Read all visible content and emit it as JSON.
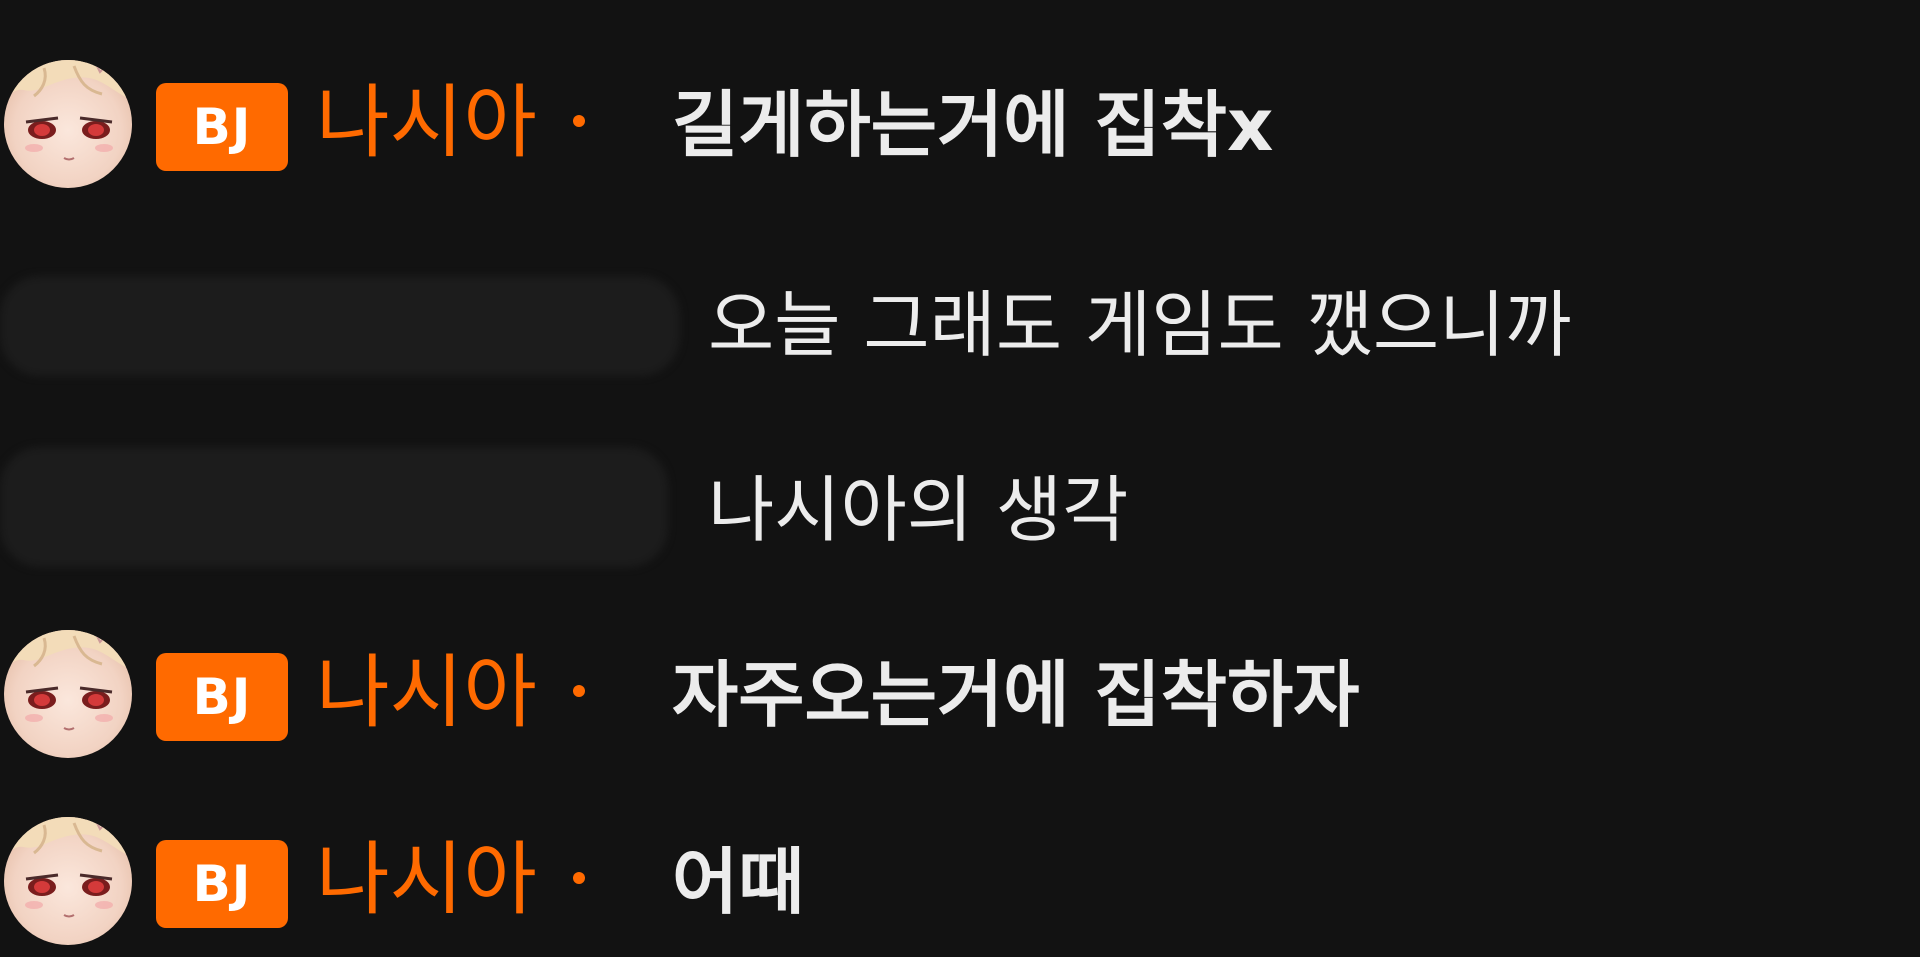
{
  "chat": {
    "messages": [
      {
        "type": "streamer",
        "badge": "BJ",
        "nickname": "나시아",
        "text": "길게하는거에 집착x"
      },
      {
        "type": "viewer",
        "text": "오늘 그래도 게임도 깼으니까"
      },
      {
        "type": "viewer",
        "text": "나시아의 생각"
      },
      {
        "type": "streamer",
        "badge": "BJ",
        "nickname": "나시아",
        "text": "자주오는거에 집착하자"
      },
      {
        "type": "streamer",
        "badge": "BJ",
        "nickname": "나시아",
        "text": "어때"
      }
    ]
  },
  "colors": {
    "background": "#121212",
    "accent": "#ff6a00",
    "message_text": "#ececec",
    "blur_mask": "#1c1c1c"
  },
  "icons": {
    "avatar": "anime-girl-avatar-icon",
    "separator": "dot-separator-icon"
  }
}
